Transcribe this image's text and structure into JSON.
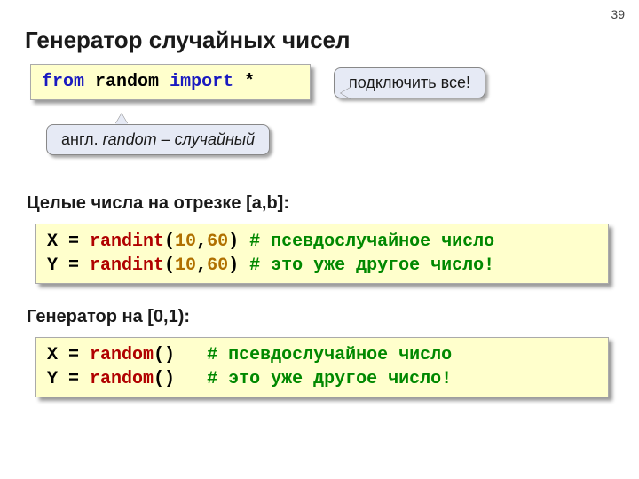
{
  "page_number": "39",
  "title": "Генератор случайных чисел",
  "import_line": {
    "kw_from": "from",
    "module": "random",
    "kw_import": "import",
    "star": "*"
  },
  "callout_connect": "подключить все!",
  "callout_english_prefix": "англ. ",
  "callout_english_word": "random",
  "callout_english_tail": " – случайный",
  "subheader_int": "Целые числа на отрезке [a,b]:",
  "randint": {
    "x_prefix": "X = ",
    "fn": "randint",
    "open": "(",
    "n1": "10",
    "comma": ",",
    "n2": "60",
    "close": ")",
    "sp": " ",
    "c1": "# псевдослучайное число",
    "y_prefix": "Y = ",
    "c2": "# это уже другое число!"
  },
  "subheader_gen": "Генератор на [0,1):",
  "randomfn": {
    "x_prefix": "X = ",
    "fn": "random",
    "paren": "()",
    "gap": "   ",
    "c1": "# псевдослучайное число",
    "y_prefix": "Y = ",
    "c2": "# это уже другое число!"
  }
}
